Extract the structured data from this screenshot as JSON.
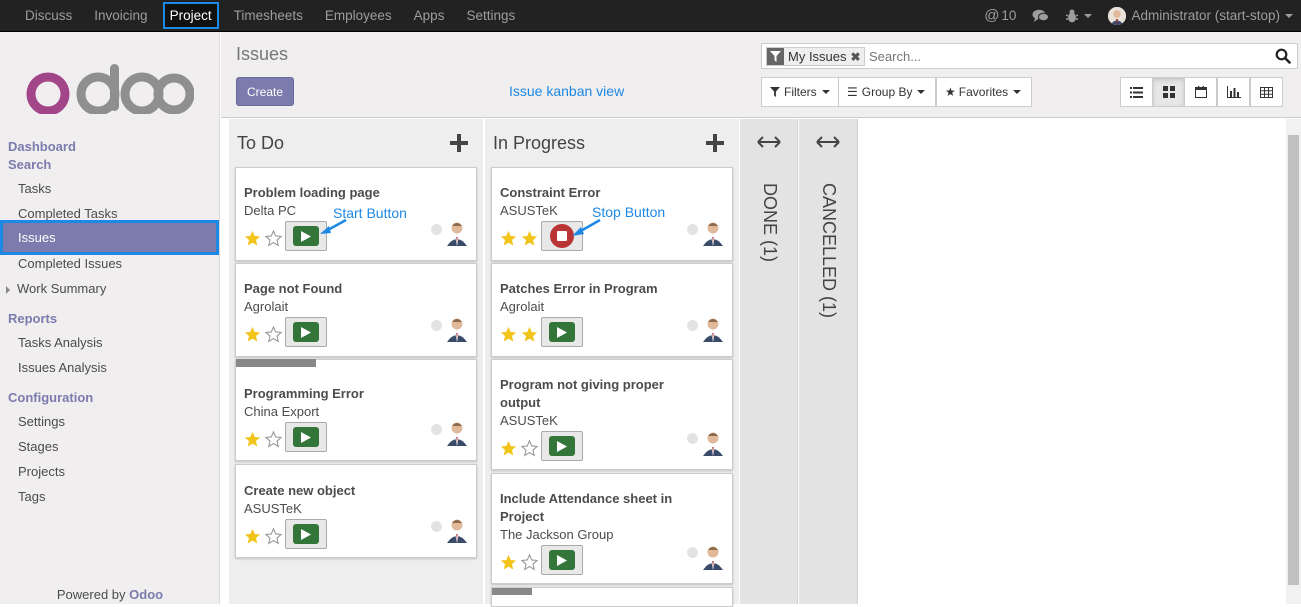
{
  "topbar": {
    "menu": [
      "Discuss",
      "Invoicing",
      "Project",
      "Timesheets",
      "Employees",
      "Apps",
      "Settings"
    ],
    "active_menu": "Project",
    "mentions_count": "10",
    "user": "Administrator (start-stop)"
  },
  "sidebar": {
    "sections": [
      {
        "title": "Dashboard"
      },
      {
        "title": "Search",
        "items": [
          "Tasks",
          "Completed Tasks",
          "Issues",
          "Completed Issues",
          "Work Summary"
        ]
      },
      {
        "title": "Reports",
        "items": [
          "Tasks Analysis",
          "Issues Analysis"
        ]
      },
      {
        "title": "Configuration",
        "items": [
          "Settings",
          "Stages",
          "Projects",
          "Tags"
        ]
      }
    ],
    "active_item": "Issues",
    "powered_by": "Powered by",
    "powered_brand": "Odoo"
  },
  "control_panel": {
    "title": "Issues",
    "create_label": "Create",
    "view_label": "Issue kanban view",
    "search_facet": "My Issues",
    "search_placeholder": "Search...",
    "filters_label": "Filters",
    "groupby_label": "Group By",
    "favorites_label": "Favorites"
  },
  "kanban": {
    "columns": [
      {
        "title": "To Do",
        "cards": [
          {
            "title": "Problem loading page",
            "subtitle": "Delta PC",
            "stars": 1,
            "timer": "start"
          },
          {
            "title": "Page not Found",
            "subtitle": "Agrolait",
            "stars": 1,
            "timer": "start"
          },
          {
            "title": "Programming Error",
            "subtitle": "China Export",
            "stars": 1,
            "timer": "start"
          },
          {
            "title": "Create new object",
            "subtitle": "ASUSTeK",
            "stars": 1,
            "timer": "start"
          }
        ]
      },
      {
        "title": "In Progress",
        "cards": [
          {
            "title": "Constraint Error",
            "subtitle": "ASUSTeK",
            "stars": 2,
            "timer": "stop"
          },
          {
            "title": "Patches Error in Program",
            "subtitle": "Agrolait",
            "stars": 2,
            "timer": "start"
          },
          {
            "title": "Program not giving proper output",
            "subtitle": "ASUSTeK",
            "stars": 1,
            "timer": "start"
          },
          {
            "title": "Include Attendance sheet in Project",
            "subtitle": "The Jackson Group",
            "stars": 1,
            "timer": "start"
          }
        ]
      }
    ],
    "folded": [
      {
        "title": "DONE (1)"
      },
      {
        "title": "CANCELLED (1)"
      }
    ]
  },
  "annotations": {
    "start": "Start Button",
    "stop": "Stop Button"
  },
  "colors": {
    "brand": "#7c7bad",
    "highlight": "#1e88e5",
    "play": "#34763a",
    "stop": "#b93434",
    "star": "#f0c419"
  }
}
